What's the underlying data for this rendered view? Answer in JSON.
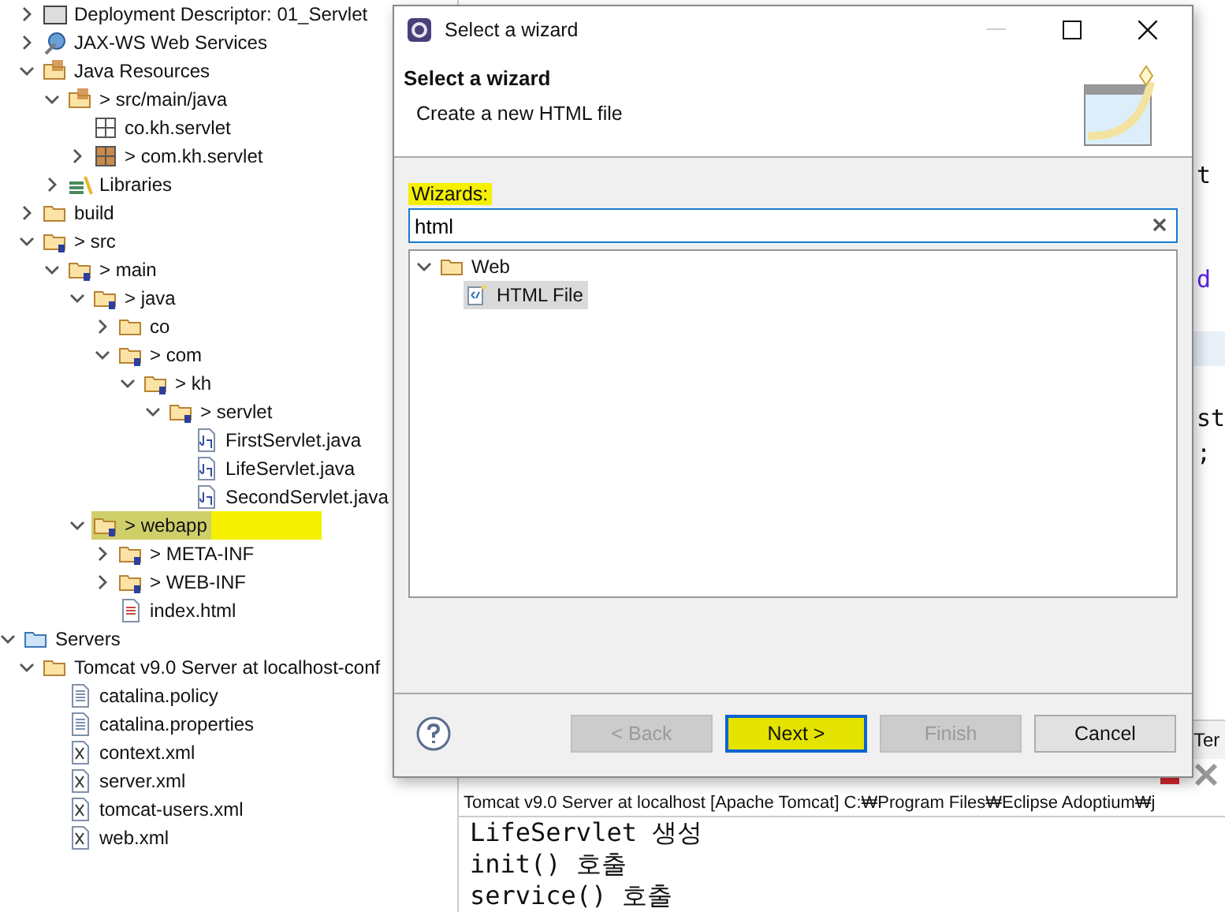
{
  "project_explorer": {
    "project_items": [
      {
        "label": "Deployment Descriptor: 01_Servlet",
        "kind": "descriptor",
        "expanded": false,
        "selected": false
      },
      {
        "label": "JAX-WS Web Services",
        "kind": "webservices",
        "expanded": false,
        "selected": false
      },
      {
        "label": "Java Resources",
        "kind": "resources",
        "expanded": true,
        "selected": false,
        "children": [
          {
            "label": "> src/main/java",
            "kind": "srcfolder",
            "expanded": true,
            "selected": false,
            "children": [
              {
                "label": "co.kh.servlet",
                "kind": "package-empty",
                "selected": false
              },
              {
                "label": "> com.kh.servlet",
                "kind": "package",
                "expanded": false,
                "selected": false
              }
            ]
          },
          {
            "label": "Libraries",
            "kind": "libraries",
            "expanded": false,
            "selected": false
          }
        ]
      },
      {
        "label": "build",
        "kind": "folder",
        "expanded": false,
        "selected": false
      },
      {
        "label": "> src",
        "kind": "folder-q",
        "expanded": true,
        "selected": false,
        "children": [
          {
            "label": "> main",
            "kind": "folder-q",
            "expanded": true,
            "selected": false,
            "children": [
              {
                "label": "> java",
                "kind": "folder-q",
                "expanded": true,
                "selected": false,
                "children": [
                  {
                    "label": "co",
                    "kind": "folder",
                    "expanded": false,
                    "selected": false
                  },
                  {
                    "label": "> com",
                    "kind": "folder-q",
                    "expanded": true,
                    "selected": false,
                    "children": [
                      {
                        "label": "> kh",
                        "kind": "folder-q",
                        "expanded": true,
                        "selected": false,
                        "children": [
                          {
                            "label": "> servlet",
                            "kind": "folder-q",
                            "expanded": true,
                            "selected": false,
                            "children": [
                              {
                                "label": "FirstServlet.java",
                                "kind": "java",
                                "selected": false
                              },
                              {
                                "label": "LifeServlet.java",
                                "kind": "java",
                                "selected": false
                              },
                              {
                                "label": "SecondServlet.java",
                                "kind": "java",
                                "selected": false
                              }
                            ]
                          }
                        ]
                      }
                    ]
                  }
                ]
              },
              {
                "label": "> webapp",
                "kind": "folder-q",
                "expanded": true,
                "selected": true,
                "highlighted": true,
                "children": [
                  {
                    "label": "> META-INF",
                    "kind": "folder-q",
                    "expanded": false,
                    "selected": false
                  },
                  {
                    "label": "> WEB-INF",
                    "kind": "folder-q",
                    "expanded": false,
                    "selected": false
                  },
                  {
                    "label": "index.html",
                    "kind": "html",
                    "selected": false
                  }
                ]
              }
            ]
          }
        ]
      }
    ],
    "server_items": [
      {
        "label": "Servers",
        "kind": "servers",
        "expanded": true,
        "selected": false,
        "children": [
          {
            "label": "Tomcat v9.0 Server at localhost-conf",
            "kind": "folder",
            "expanded": true,
            "selected": false,
            "children": [
              {
                "label": "catalina.policy",
                "kind": "text",
                "selected": false
              },
              {
                "label": "catalina.properties",
                "kind": "text",
                "selected": false
              },
              {
                "label": "context.xml",
                "kind": "xml",
                "selected": false
              },
              {
                "label": "server.xml",
                "kind": "xml",
                "selected": false
              },
              {
                "label": "tomcat-users.xml",
                "kind": "xml",
                "selected": false
              },
              {
                "label": "web.xml",
                "kind": "xml",
                "selected": false
              }
            ]
          }
        ]
      }
    ]
  },
  "editor": {
    "lines": [
      {
        "kind": "code",
        "text": "t"
      },
      {
        "kind": "blank"
      },
      {
        "kind": "blank"
      },
      {
        "kind": "keyword",
        "text": "d"
      },
      {
        "kind": "blank"
      },
      {
        "kind": "current"
      },
      {
        "kind": "blank"
      },
      {
        "kind": "code",
        "text": "st"
      },
      {
        "kind": "code",
        "text": ";"
      }
    ]
  },
  "console": {
    "tab": "Ter",
    "title": "Tomcat v9.0 Server at localhost [Apache Tomcat] C:₩Program Files₩Eclipse Adoptium₩j",
    "lines": [
      "LifeServlet 생성",
      "init() 호출",
      "service() 호출"
    ]
  },
  "dialog": {
    "title": "Select a wizard",
    "heading": "Select a wizard",
    "description": "Create a new HTML file",
    "filter_label": "Wizards:",
    "filter_label_highlighted": true,
    "filter": {
      "value": "html"
    },
    "wizards": [
      {
        "label": "Web",
        "kind": "folder",
        "expanded": true,
        "selected": false,
        "children": [
          {
            "label": "HTML File",
            "kind": "htmlwizard",
            "selected": true
          }
        ]
      }
    ],
    "buttons": [
      {
        "label": "< Back",
        "disabled": true,
        "default": false,
        "highlighted": false
      },
      {
        "label": "Next >",
        "disabled": false,
        "default": true,
        "highlighted": true
      },
      {
        "label": "Finish",
        "disabled": true,
        "default": false,
        "highlighted": false
      },
      {
        "label": "Cancel",
        "disabled": false,
        "default": false,
        "highlighted": false
      }
    ]
  }
}
